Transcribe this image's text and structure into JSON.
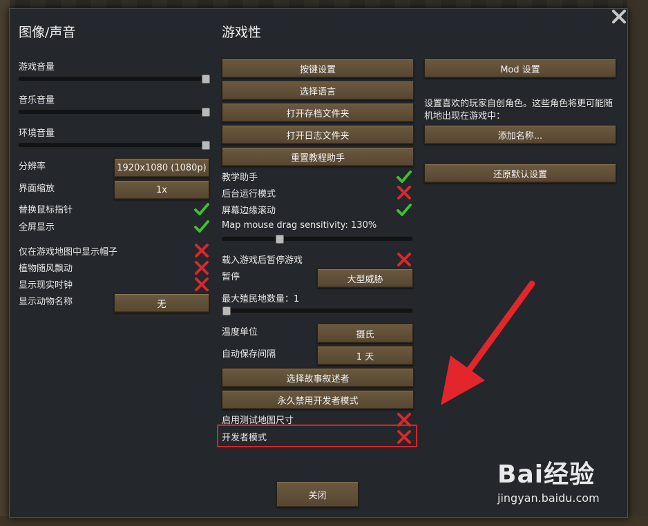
{
  "left": {
    "title": "图像/声音",
    "game_volume": "游戏音量",
    "music_volume": "音乐音量",
    "ambient_volume": "环境音量",
    "resolution_label": "分辨率",
    "resolution_value": "1920x1080 (1080p)",
    "ui_scale_label": "界面缩放",
    "ui_scale_value": "1x",
    "custom_cursor_label": "替换鼠标指针",
    "fullscreen_label": "全屏显示",
    "hats_only_on_map_label": "仅在游戏地图中显示帽子",
    "plant_sway_label": "植物随风飘动",
    "real_clock_label": "显示现实时钟",
    "animal_names_label": "显示动物名称",
    "animal_names_value": "无",
    "game_volume_level": 1.0,
    "music_volume_level": 1.0,
    "ambient_volume_level": 1.0
  },
  "middle": {
    "title": "游戏性",
    "keybinds_button": "按键设置",
    "language_button": "选择语言",
    "open_save_folder_button": "打开存档文件夹",
    "open_log_folder_button": "打开日志文件夹",
    "reset_tutor_button": "重置教程助手",
    "tutor_label": "教学助手",
    "run_in_background_label": "后台运行模式",
    "edge_scroll_label": "屏幕边缘滚动",
    "drag_sensitivity_label": "Map mouse drag sensitivity: 130%",
    "drag_sensitivity_level": 0.3,
    "pause_on_load_label": "载入游戏后暂停游戏",
    "pause_label": "暂停",
    "pause_value": "大型威胁",
    "max_colonies_label": "最大殖民地数量：1",
    "max_colonies_level": 0.0,
    "temp_unit_label": "温度单位",
    "temp_unit_value": "摄氏",
    "autosave_label": "自动保存间隔",
    "autosave_value": "1 天",
    "storyteller_button": "选择故事叙述者",
    "disable_dev_button": "永久禁用开发者模式",
    "test_map_sizes_label": "启用测试地图尺寸",
    "dev_mode_label": "开发者模式"
  },
  "right": {
    "mod_settings_button": "Mod 设置",
    "names_info": "设置喜欢的玩家自创角色。这些角色将更可能随机地出现在游戏中：",
    "add_name_button": "添加名称...",
    "restore_defaults_button": "还原默认设置"
  },
  "close_button": "关闭",
  "watermark": {
    "main": "Bai经验",
    "sub": "jingyan.baidu.com"
  },
  "colors": {
    "check": "#3fbf2f",
    "cross": "#d8282e",
    "button": "#5f4f37",
    "highlight": "#d8242a",
    "arrow": "#e3262c"
  }
}
